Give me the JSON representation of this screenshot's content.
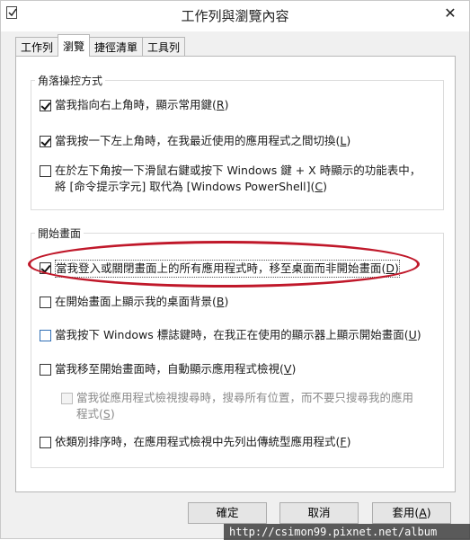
{
  "window": {
    "title": "工作列與瀏覽內容",
    "close_glyph": "✕",
    "app_icon": "taskbar-check-icon"
  },
  "tabs": [
    {
      "label": "工作列",
      "active": false
    },
    {
      "label": "瀏覽",
      "active": true
    },
    {
      "label": "捷徑清單",
      "active": false
    },
    {
      "label": "工具列",
      "active": false
    }
  ],
  "corner_group": {
    "legend": "角落操控方式",
    "options": [
      {
        "pre": "當我指向右上角時，顯示常用鍵(",
        "key": "R",
        "post": ")",
        "checked": true
      },
      {
        "pre": "當我按一下左上角時，在我最近使用的應用程式之間切換(",
        "key": "L",
        "post": ")",
        "checked": true
      },
      {
        "line1": "在於左下角按一下滑鼠右鍵或按下 Windows 鍵 + X 時顯示的功能表中，",
        "pre": "將 [命令提示字元] 取代為 [Windows PowerShell](",
        "key": "C",
        "post": ")",
        "checked": false
      }
    ]
  },
  "start_group": {
    "legend": "開始畫面",
    "options": [
      {
        "pre": "當我登入或關閉畫面上的所有應用程式時，移至桌面而非開始畫面(",
        "key": "D",
        "post": ")",
        "checked": true,
        "highlighted": true
      },
      {
        "pre": "在開始畫面上顯示我的桌面背景(",
        "key": "B",
        "post": ")",
        "checked": false
      },
      {
        "pre": "當我按下 Windows 標誌鍵時，在我正在使用的顯示器上顯示開始畫面(",
        "key": "U",
        "post": ")",
        "checked": false
      },
      {
        "pre": "當我移至開始畫面時，自動顯示應用程式檢視(",
        "key": "V",
        "post": ")",
        "checked": false
      },
      {
        "line1": "當我從應用程式檢視搜尋時，搜尋所有位置，而不要只搜尋我的應用",
        "pre": "程式(",
        "key": "S",
        "post": ")",
        "checked": false,
        "disabled": true
      },
      {
        "pre": "依類別排序時，在應用程式檢視中先列出傳統型應用程式(",
        "key": "F",
        "post": ")",
        "checked": false
      }
    ]
  },
  "buttons": {
    "ok": "確定",
    "cancel": "取消",
    "apply_pre": "套用(",
    "apply_key": "A",
    "apply_post": ")"
  },
  "watermark": "http://csimon99.pixnet.net/album",
  "colors": {
    "highlight_ellipse": "#c0182a",
    "focus_checkbox": "#2f6fb5"
  }
}
